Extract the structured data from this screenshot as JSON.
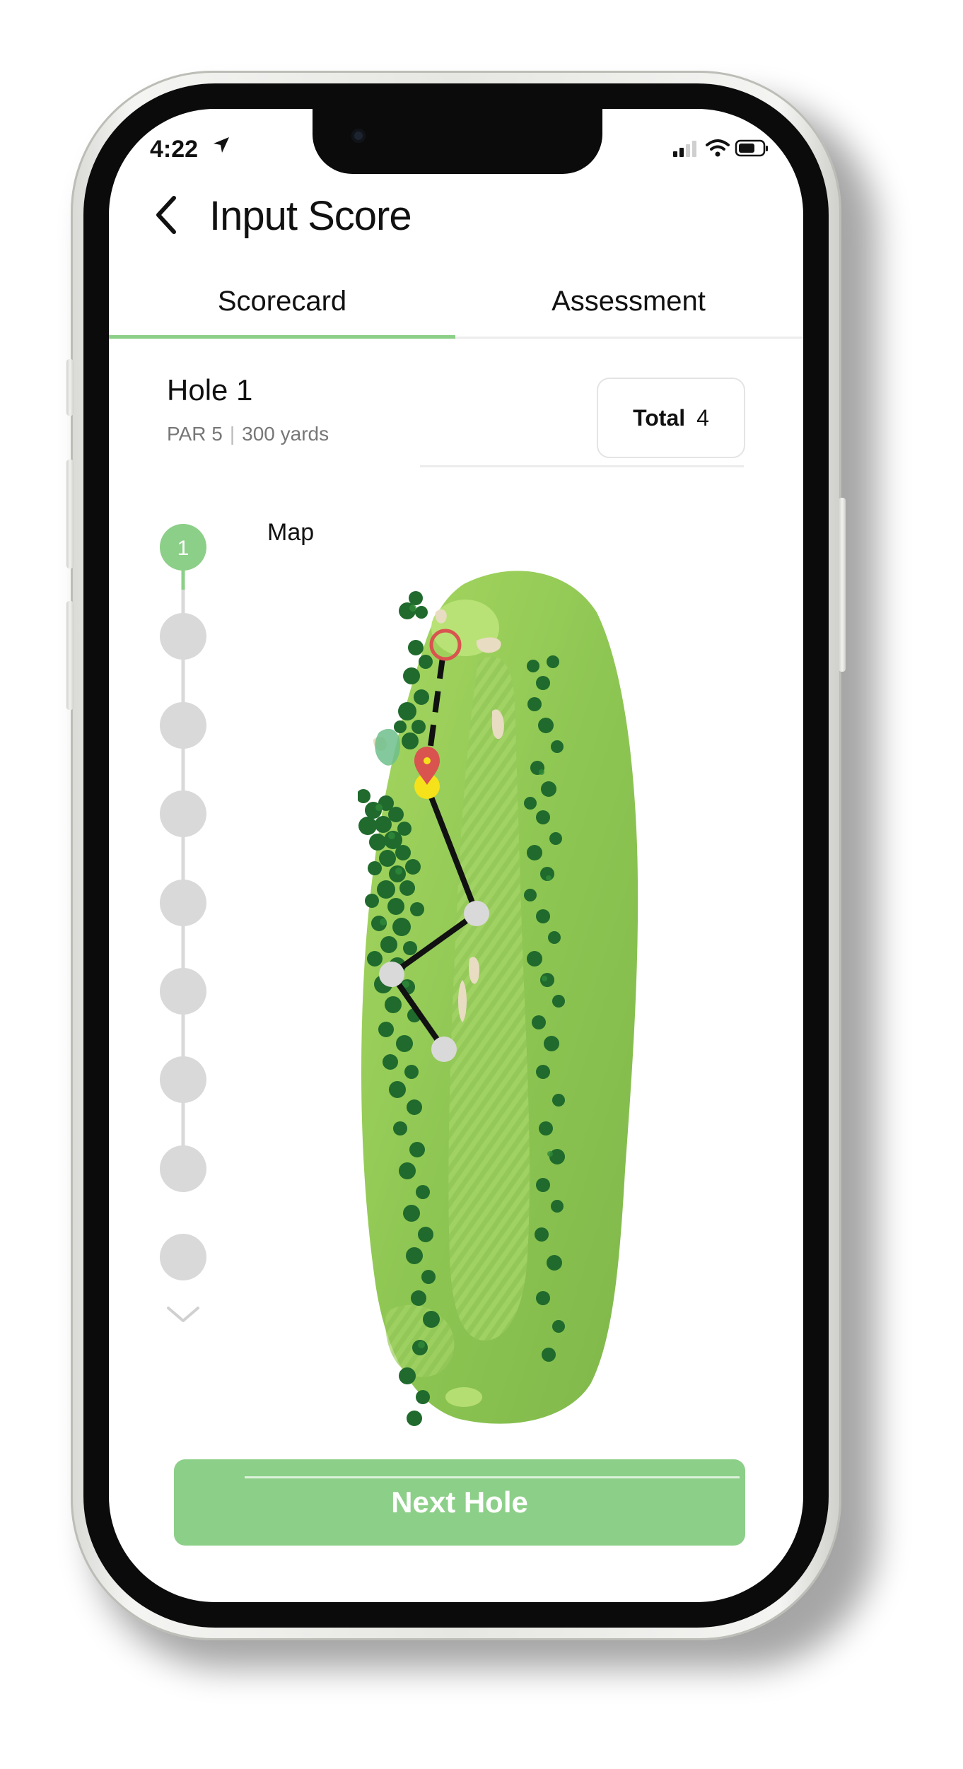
{
  "status_bar": {
    "time": "4:22"
  },
  "header": {
    "title": "Input Score"
  },
  "tabs": [
    {
      "label": "Scorecard",
      "active": true
    },
    {
      "label": "Assessment",
      "active": false
    }
  ],
  "hole": {
    "title": "Hole 1",
    "par": "PAR 5",
    "distance": "300 yards",
    "total_label": "Total",
    "total_value": "4"
  },
  "stepper": {
    "first_step_label": "1",
    "step_count": 9,
    "active_step": 1
  },
  "map": {
    "label": "Map"
  },
  "footer": {
    "next_label": "Next Hole"
  },
  "colors": {
    "accent": "#8ccf88",
    "pin_red": "#d9534f",
    "ball_yellow": "#f6e21a",
    "fairway": "#8fc653"
  }
}
